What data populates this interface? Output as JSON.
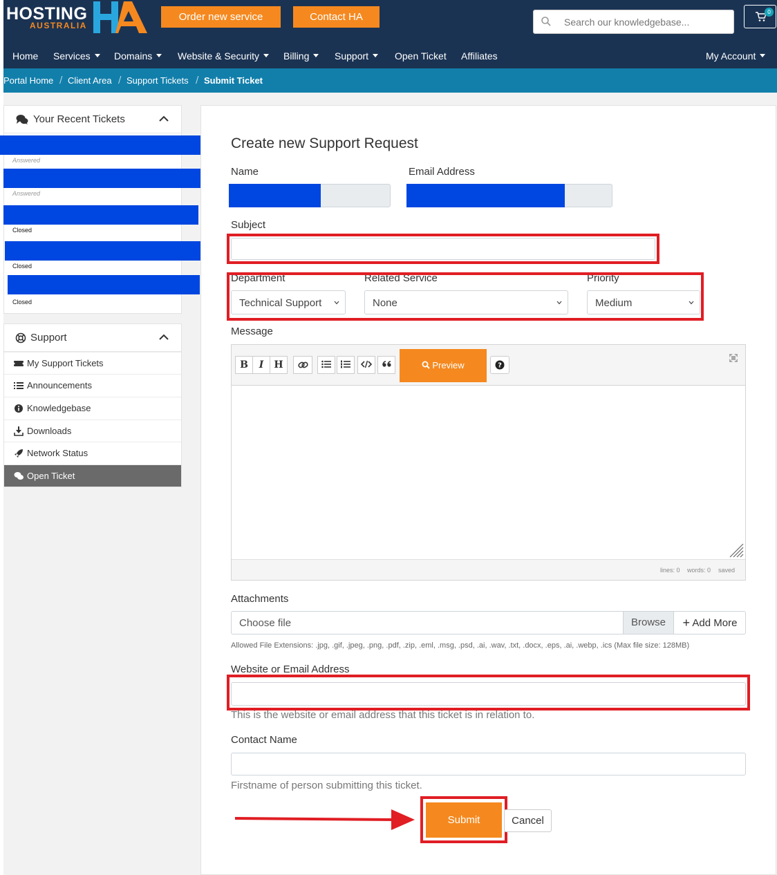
{
  "header": {
    "logo": {
      "line1": "HOSTING",
      "line2": "AUSTRALIA",
      "mark": "HA"
    },
    "order_button": "Order new service",
    "contact_button": "Contact HA",
    "search_placeholder": "Search our knowledgebase...",
    "cart_count": "0"
  },
  "nav": {
    "items": [
      {
        "label": "Home",
        "dropdown": false
      },
      {
        "label": "Services",
        "dropdown": true
      },
      {
        "label": "Domains",
        "dropdown": true
      },
      {
        "label": "Website & Security",
        "dropdown": true
      },
      {
        "label": "Billing",
        "dropdown": true
      },
      {
        "label": "Support",
        "dropdown": true
      },
      {
        "label": "Open Ticket",
        "dropdown": false
      },
      {
        "label": "Affiliates",
        "dropdown": false
      }
    ],
    "account": "My Account"
  },
  "breadcrumb": [
    "Portal Home",
    "Client Area",
    "Support Tickets",
    "Submit Ticket"
  ],
  "sidebar": {
    "recent_tickets_title": "Your Recent Tickets",
    "tickets": [
      {
        "status": "Answered"
      },
      {
        "status": "Answered"
      },
      {
        "status": "Closed"
      },
      {
        "status": "Closed"
      },
      {
        "status": "Closed"
      }
    ],
    "support_title": "Support",
    "support_items": [
      {
        "label": "My Support Tickets",
        "icon": "ticket-icon"
      },
      {
        "label": "Announcements",
        "icon": "list-icon"
      },
      {
        "label": "Knowledgebase",
        "icon": "info-icon"
      },
      {
        "label": "Downloads",
        "icon": "download-icon"
      },
      {
        "label": "Network Status",
        "icon": "rocket-icon"
      },
      {
        "label": "Open Ticket",
        "icon": "comments-icon",
        "active": true
      }
    ]
  },
  "form": {
    "title": "Create new Support Request",
    "name_label": "Name",
    "email_label": "Email Address",
    "subject_label": "Subject",
    "department_label": "Department",
    "department_value": "Technical Support",
    "related_service_label": "Related Service",
    "related_service_value": "None",
    "priority_label": "Priority",
    "priority_value": "Medium",
    "message_label": "Message",
    "preview_button": "Preview",
    "editor_status": {
      "lines": "lines: 0",
      "words": "words: 0",
      "saved": "saved"
    },
    "attachments_label": "Attachments",
    "choose_file": "Choose file",
    "browse_button": "Browse",
    "add_more_button": "Add More",
    "allowed_extensions": "Allowed File Extensions: .jpg, .gif, .jpeg, .png, .pdf, .zip, .eml, .msg, .psd, .ai, .wav, .txt, .docx, .eps, .ai, .webp, .ics (Max file size: 128MB)",
    "website_label": "Website or Email Address",
    "website_help": "This is the website or email address that this ticket is in relation to.",
    "contact_name_label": "Contact Name",
    "contact_name_help": "Firstname of person submitting this ticket.",
    "submit_button": "Submit",
    "cancel_button": "Cancel"
  },
  "colors": {
    "header_bg": "#1b3353",
    "breadcrumb_bg": "#127fab",
    "accent_orange": "#f5891f",
    "highlight_red": "#e01e24",
    "redaction_blue": "#0046e0"
  }
}
